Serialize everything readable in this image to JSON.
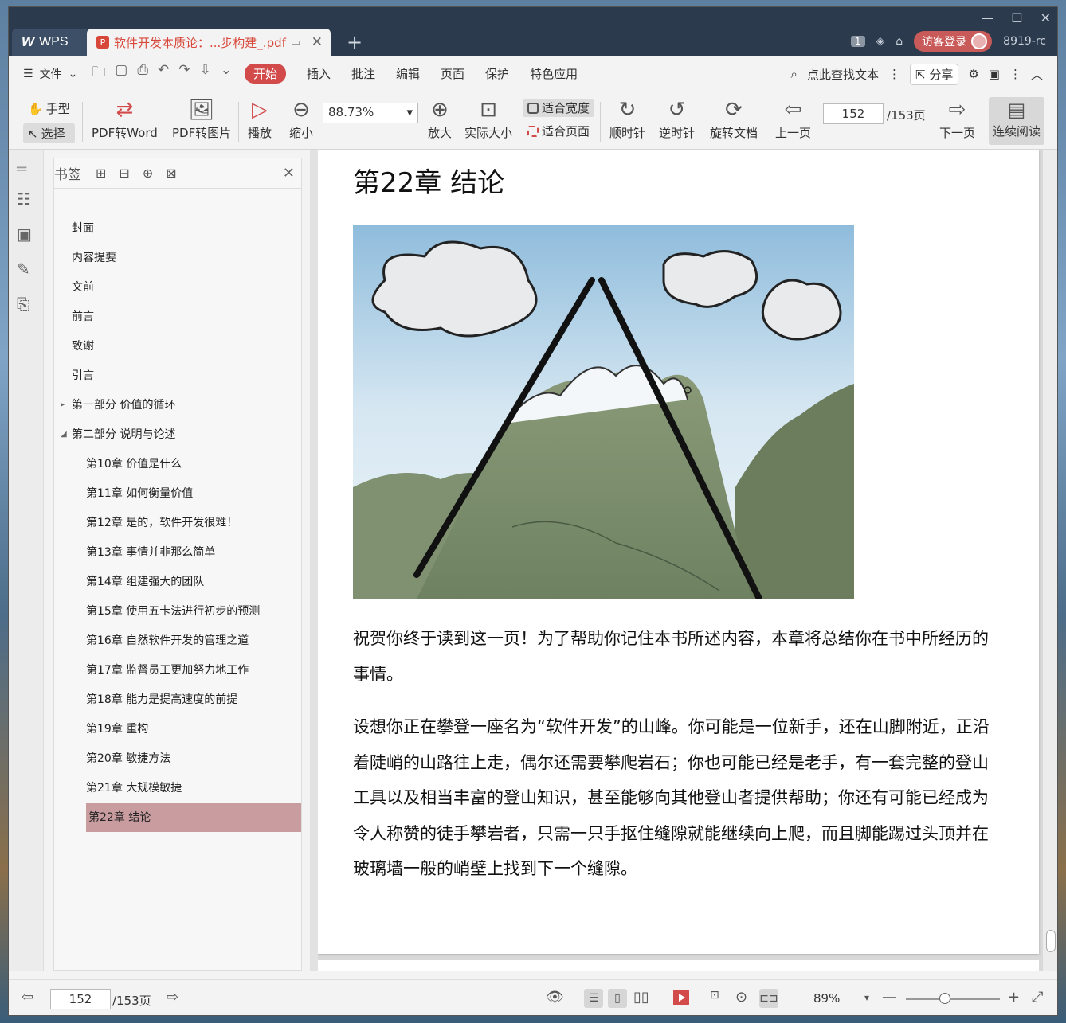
{
  "window": {
    "tabs": {
      "wps_label": "WPS",
      "doc_label": "软件开发本质论：...步构建_.pdf"
    },
    "right": {
      "badge": "1",
      "login_label": "访客登录",
      "user_id": "8919-rc"
    }
  },
  "menubar": {
    "file_label": "文件",
    "items": [
      "开始",
      "插入",
      "批注",
      "编辑",
      "页面",
      "保护",
      "特色应用"
    ],
    "active": "开始",
    "search_label": "点此查找文本",
    "share_label": "分享"
  },
  "toolbar": {
    "hand_label": "手型",
    "select_label": "选择",
    "pdf2word": "PDF转Word",
    "pdf2img": "PDF转图片",
    "play": "播放",
    "zoom_out": "缩小",
    "zoom_value": "88.73%",
    "zoom_in": "放大",
    "actual_size": "实际大小",
    "fit_width": "适合宽度",
    "fit_page": "适合页面",
    "clockwise": "顺时针",
    "counter_clockwise": "逆时针",
    "rotate_doc": "旋转文档",
    "prev_page": "上一页",
    "page_value": "152",
    "page_total": "/153页",
    "next_page": "下一页",
    "continuous": "连续阅读"
  },
  "bookmarks": {
    "title": "书签",
    "items": [
      {
        "label": "封面",
        "level": 0
      },
      {
        "label": "内容提要",
        "level": 0
      },
      {
        "label": "文前",
        "level": 0
      },
      {
        "label": "前言",
        "level": 0
      },
      {
        "label": "致谢",
        "level": 0
      },
      {
        "label": "引言",
        "level": 0
      },
      {
        "label": "第一部分 价值的循环",
        "level": 0,
        "expander": "collapsed"
      },
      {
        "label": "第二部分 说明与论述",
        "level": 0,
        "expander": "expanded"
      },
      {
        "label": "第10章 价值是什么",
        "level": 1
      },
      {
        "label": "第11章 如何衡量价值",
        "level": 1
      },
      {
        "label": "第12章 是的，软件开发很难！",
        "level": 1
      },
      {
        "label": "第13章 事情并非那么简单",
        "level": 1
      },
      {
        "label": "第14章 组建强大的团队",
        "level": 1
      },
      {
        "label": "第15章 使用五卡法进行初步的预测",
        "level": 1
      },
      {
        "label": "第16章 自然软件开发的管理之道",
        "level": 1
      },
      {
        "label": "第17章 监督员工更加努力地工作",
        "level": 1
      },
      {
        "label": "第18章 能力是提高速度的前提",
        "level": 1
      },
      {
        "label": "第19章 重构",
        "level": 1
      },
      {
        "label": "第20章 敏捷方法",
        "level": 1
      },
      {
        "label": "第21章 大规模敏捷",
        "level": 1
      },
      {
        "label": "第22章 结论",
        "level": 1,
        "selected": true
      }
    ]
  },
  "document": {
    "chapter_title": "第22章  结论",
    "para1": "祝贺你终于读到这一页！为了帮助你记住本书所述内容，本章将总结你在书中所经历的事情。",
    "para2": "设想你正在攀登一座名为“软件开发”的山峰。你可能是一位新手，还在山脚附近，正沿着陡峭的山路往上走，偶尔还需要攀爬岩石；你也可能已经是老手，有一套完整的登山工具以及相当丰富的登山知识，甚至能够向其他登山者提供帮助；你还有可能已经成为令人称赞的徒手攀岩者，只需一只手抠住缝隙就能继续向上爬，而且脚能踢过头顶并在玻璃墙一般的峭壁上找到下一个缝隙。"
  },
  "statusbar": {
    "page_value": "152",
    "page_total": "/153页",
    "zoom_value": "89%"
  },
  "colors": {
    "accent": "#d24a4a",
    "titlebar": "#2b3a4d",
    "selected_bookmark": "#c99ca0"
  }
}
